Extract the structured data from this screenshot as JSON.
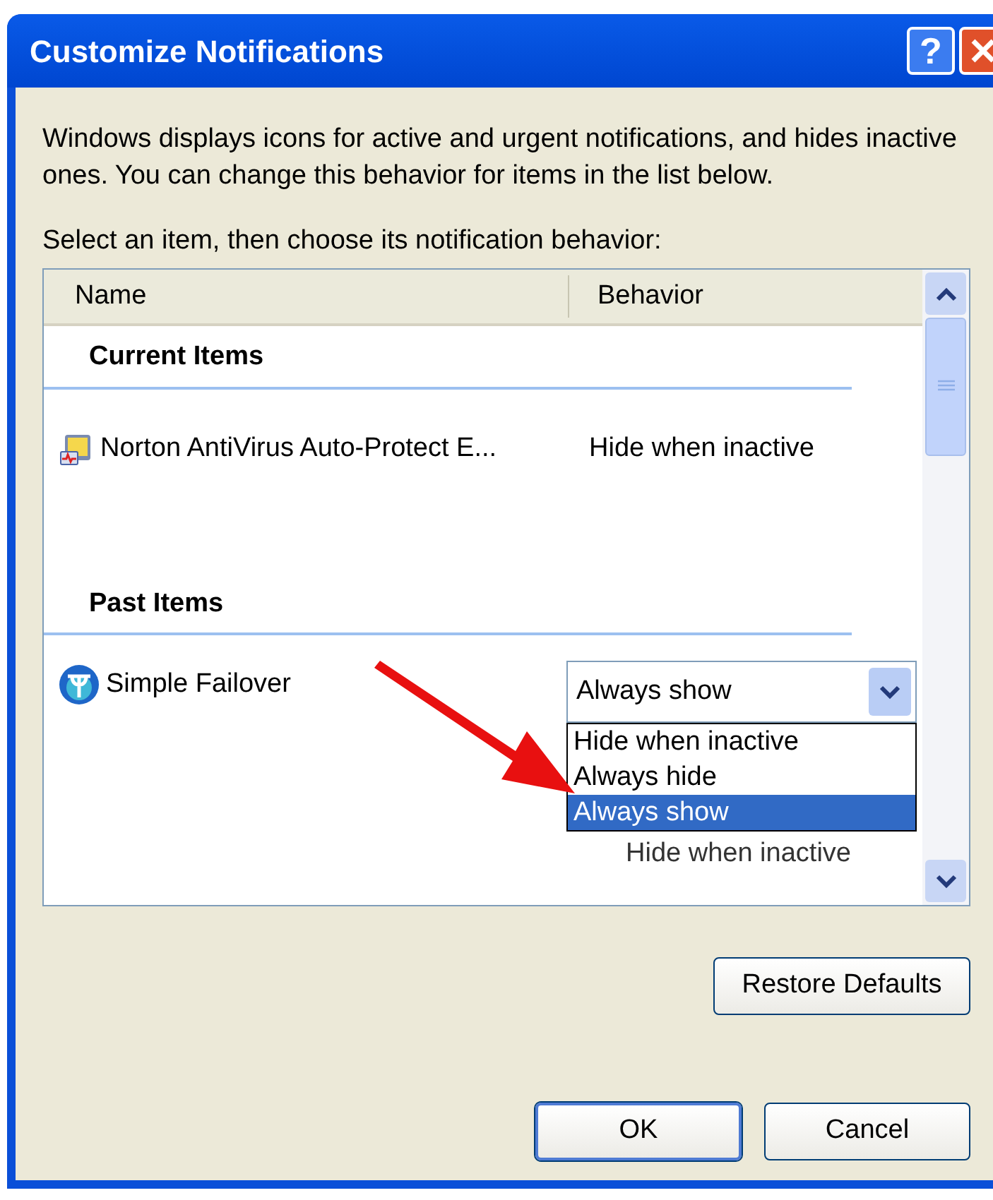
{
  "window": {
    "title": "Customize Notifications",
    "help_button": {
      "label": "?"
    }
  },
  "description": "Windows displays icons for active and urgent notifications, and hides inactive ones. You can change this behavior for items in the list below.",
  "prompt": "Select an item, then choose its notification behavior:",
  "list": {
    "columns": [
      "Name",
      "Behavior"
    ],
    "groups": [
      {
        "title": "Current Items",
        "items": [
          {
            "kind": "text",
            "name": "Norton AntiVirus Auto-Protect E...",
            "behavior": "Hide when inactive"
          }
        ]
      },
      {
        "title": "Past Items",
        "items": [
          {
            "kind": "dropdown",
            "name": "Simple Failover",
            "behavior": "Always show",
            "expanded": true,
            "options": [
              {
                "label": "Hide when inactive",
                "selected": false
              },
              {
                "label": "Always hide",
                "selected": false
              },
              {
                "label": "Always show",
                "selected": true
              }
            ]
          },
          {
            "kind": "text",
            "behavior": "Hide when inactive"
          }
        ]
      }
    ]
  },
  "restore_button": "Restore Defaults",
  "buttons": [
    {
      "label": "OK",
      "default": true
    },
    {
      "label": "Cancel",
      "default": false
    }
  ]
}
